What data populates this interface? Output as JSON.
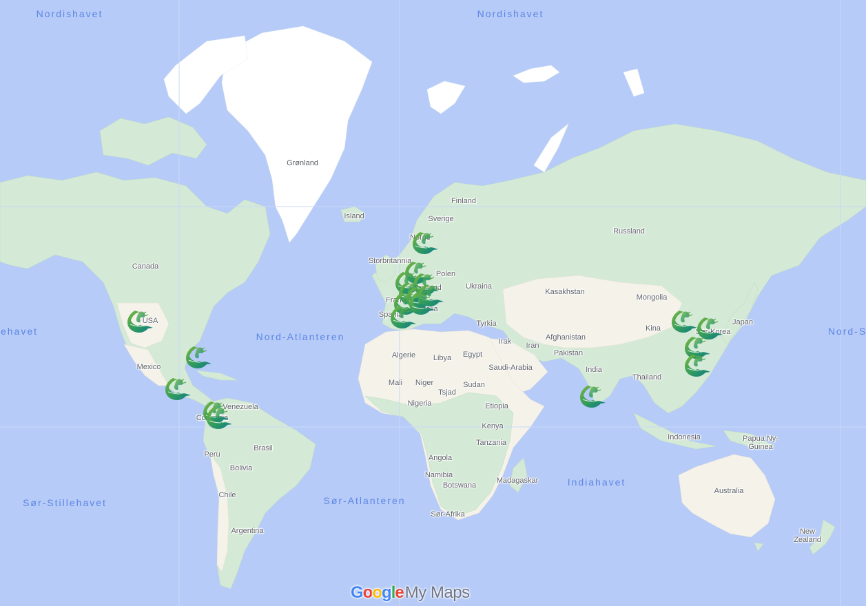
{
  "app": {
    "brand_google": "Google",
    "brand_product": "My Maps"
  },
  "brand_letters": [
    {
      "ch": "G",
      "color": "#4285f4"
    },
    {
      "ch": "o",
      "color": "#ea4335"
    },
    {
      "ch": "o",
      "color": "#fbbc05"
    },
    {
      "ch": "g",
      "color": "#4285f4"
    },
    {
      "ch": "l",
      "color": "#34a853"
    },
    {
      "ch": "e",
      "color": "#ea4335"
    }
  ],
  "colors": {
    "water": "#b6cbf7",
    "ocean_label": "#5c85e5",
    "place_label": "#5f6368",
    "marker_gradient_start": "#7cb83f",
    "marker_gradient_end": "#0e7a8a"
  },
  "oceans": [
    {
      "name": "Nordishavet",
      "id": "arctic-west"
    },
    {
      "name": "Nordishavet",
      "id": "arctic-east"
    },
    {
      "name": "ehavet",
      "id": "pacific-north-west"
    },
    {
      "name": "Nord-Atlanteren",
      "id": "north-atlantic"
    },
    {
      "name": "Nord-S",
      "id": "pacific-north-east"
    },
    {
      "name": "Sør-Stillehavet",
      "id": "south-pacific"
    },
    {
      "name": "Sør-Atlanteren",
      "id": "south-atlantic"
    },
    {
      "name": "Indiahavet",
      "id": "indian-ocean"
    }
  ],
  "places": [
    "Grønland",
    "Island",
    "Finland",
    "Sverige",
    "Norge",
    "Russland",
    "Storbritannia",
    "Polen",
    "Tyskland",
    "Ukraina",
    "Frankrike",
    "Spania",
    "Italia",
    "Kasakhstan",
    "Mongolia",
    "Tyrkia",
    "Kina",
    "Japan",
    "Sør-Korea",
    "Irak",
    "Iran",
    "Afghanistan",
    "Pakistan",
    "India",
    "Thailand",
    "Algerie",
    "Libya",
    "Egypt",
    "Saudi-Arabia",
    "Mali",
    "Niger",
    "Tsjad",
    "Sudan",
    "Nigeria",
    "Etiopia",
    "Kenya",
    "Tanzania",
    "Angola",
    "Namibia",
    "Botswana",
    "Madagaskar",
    "Sør-Afrika",
    "Indonesia",
    "Papua Ny-Guinea",
    "Australia",
    "New Zealand",
    "Canada",
    "USA",
    "Mexico",
    "Venezuela",
    "Colombia",
    "Peru",
    "Brasil",
    "Bolivia",
    "Chile",
    "Argentina"
  ],
  "markers": [
    {
      "icon": "whale-marker",
      "region": "USA"
    },
    {
      "icon": "whale-marker",
      "region": "Florida"
    },
    {
      "icon": "whale-marker",
      "region": "Central America"
    },
    {
      "icon": "whale-marker",
      "region": "Colombia"
    },
    {
      "icon": "whale-marker",
      "region": "Colombia"
    },
    {
      "icon": "whale-marker",
      "region": "Norway"
    },
    {
      "icon": "whale-marker",
      "region": "Denmark"
    },
    {
      "icon": "whale-marker",
      "region": "Netherlands"
    },
    {
      "icon": "whale-marker",
      "region": "Germany"
    },
    {
      "icon": "whale-marker",
      "region": "Belgium"
    },
    {
      "icon": "whale-marker",
      "region": "France"
    },
    {
      "icon": "whale-marker",
      "region": "Switzerland"
    },
    {
      "icon": "whale-marker",
      "region": "Austria"
    },
    {
      "icon": "whale-marker",
      "region": "Italy"
    },
    {
      "icon": "whale-marker",
      "region": "Spain"
    },
    {
      "icon": "whale-marker",
      "region": "India"
    },
    {
      "icon": "whale-marker",
      "region": "Beijing"
    },
    {
      "icon": "whale-marker",
      "region": "South Korea"
    },
    {
      "icon": "whale-marker",
      "region": "Shanghai"
    },
    {
      "icon": "whale-marker",
      "region": "Taiwan"
    }
  ]
}
